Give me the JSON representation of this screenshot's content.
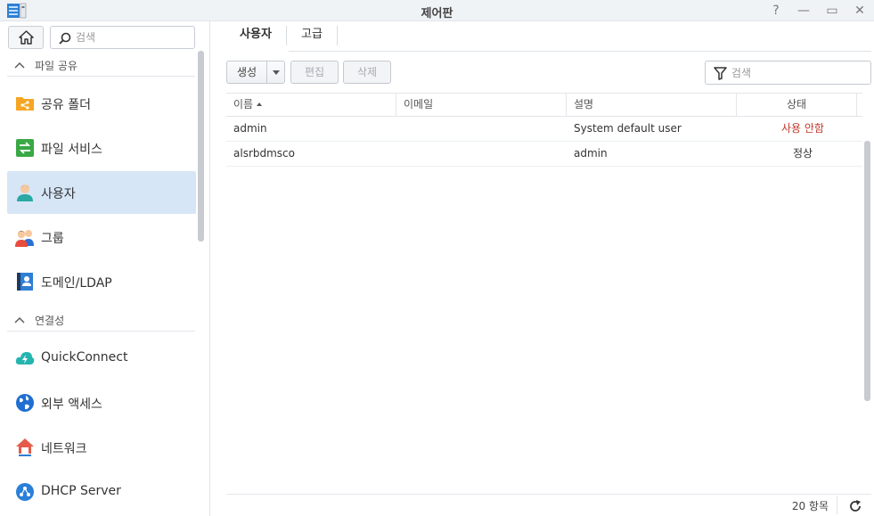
{
  "window": {
    "title": "제어판",
    "help": "?",
    "minimize": "—",
    "maximize": "▭",
    "close": "✕"
  },
  "sidebar": {
    "search_placeholder": "검색",
    "sections": [
      {
        "label": "파일 공유"
      },
      {
        "label": "연결성"
      }
    ],
    "items": [
      {
        "label": "공유 폴더",
        "icon": "shared-folder-icon"
      },
      {
        "label": "파일 서비스",
        "icon": "file-services-icon"
      },
      {
        "label": "사용자",
        "icon": "user-icon",
        "active": true
      },
      {
        "label": "그룹",
        "icon": "group-icon"
      },
      {
        "label": "도메인/LDAP",
        "icon": "domain-ldap-icon"
      },
      {
        "label": "QuickConnect",
        "icon": "quickconnect-icon"
      },
      {
        "label": "외부 액세스",
        "icon": "external-access-icon"
      },
      {
        "label": "네트워크",
        "icon": "network-icon"
      },
      {
        "label": "DHCP Server",
        "icon": "dhcp-server-icon"
      }
    ]
  },
  "main": {
    "tabs": [
      {
        "label": "사용자",
        "active": true
      },
      {
        "label": "고급"
      }
    ],
    "toolbar": {
      "create": "생성",
      "edit": "편집",
      "delete": "삭제",
      "search_placeholder": "검색"
    },
    "table": {
      "columns": [
        "이름",
        "이메일",
        "설명",
        "상태"
      ],
      "rows": [
        {
          "name": "admin",
          "email": "",
          "description": "System default user",
          "status": "사용 안함"
        },
        {
          "name": "alsrbdmsco",
          "email": "",
          "description": "admin",
          "status": "정상"
        }
      ]
    },
    "footer": {
      "count": "20 항목"
    }
  },
  "colors": {
    "accent": "#d6e6f7",
    "disabled_status": "#c0392b"
  }
}
